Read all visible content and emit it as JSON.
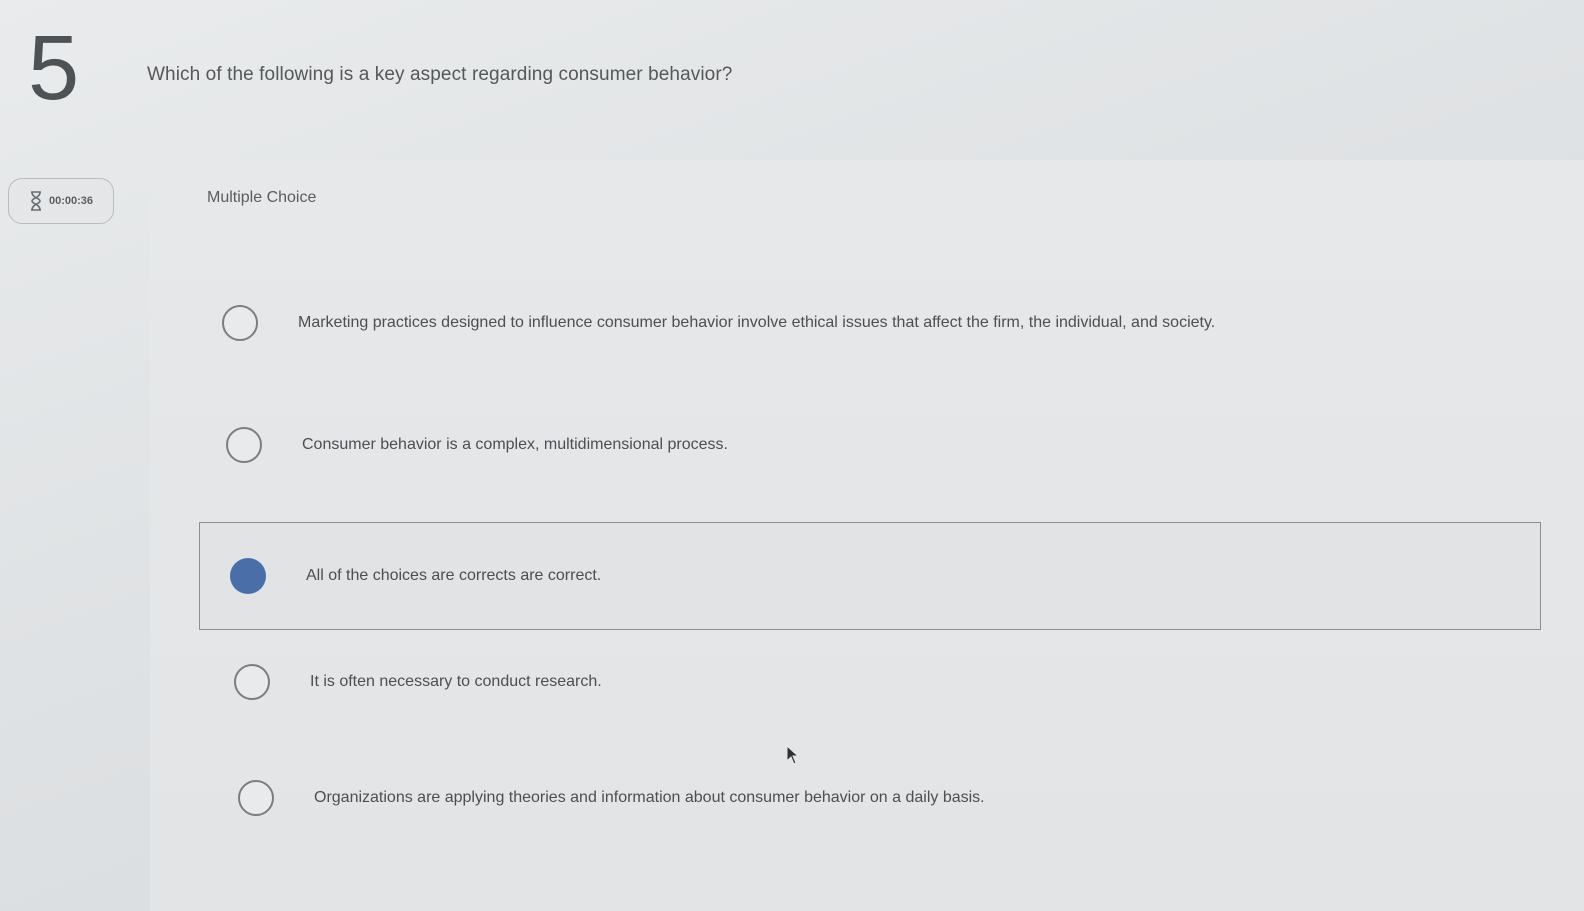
{
  "question": {
    "number": "5",
    "text": "Which of the following is a key aspect regarding consumer behavior?",
    "type_label": "Multiple Choice"
  },
  "timer": {
    "icon": "hourglass-icon",
    "value": "00:00:36"
  },
  "options": [
    {
      "label": "Marketing practices designed to influence consumer behavior involve ethical issues that affect the firm, the individual, and society.",
      "selected": false
    },
    {
      "label": "Consumer behavior is a complex, multidimensional process.",
      "selected": false
    },
    {
      "label": "All of the choices are corrects are correct.",
      "selected": true
    },
    {
      "label": "It is often necessary to conduct research.",
      "selected": false
    },
    {
      "label": "Organizations are applying theories and information about consumer behavior on a daily basis.",
      "selected": false
    }
  ],
  "colors": {
    "selected_radio": "#4a6fa8",
    "text": "#4c4f52"
  }
}
